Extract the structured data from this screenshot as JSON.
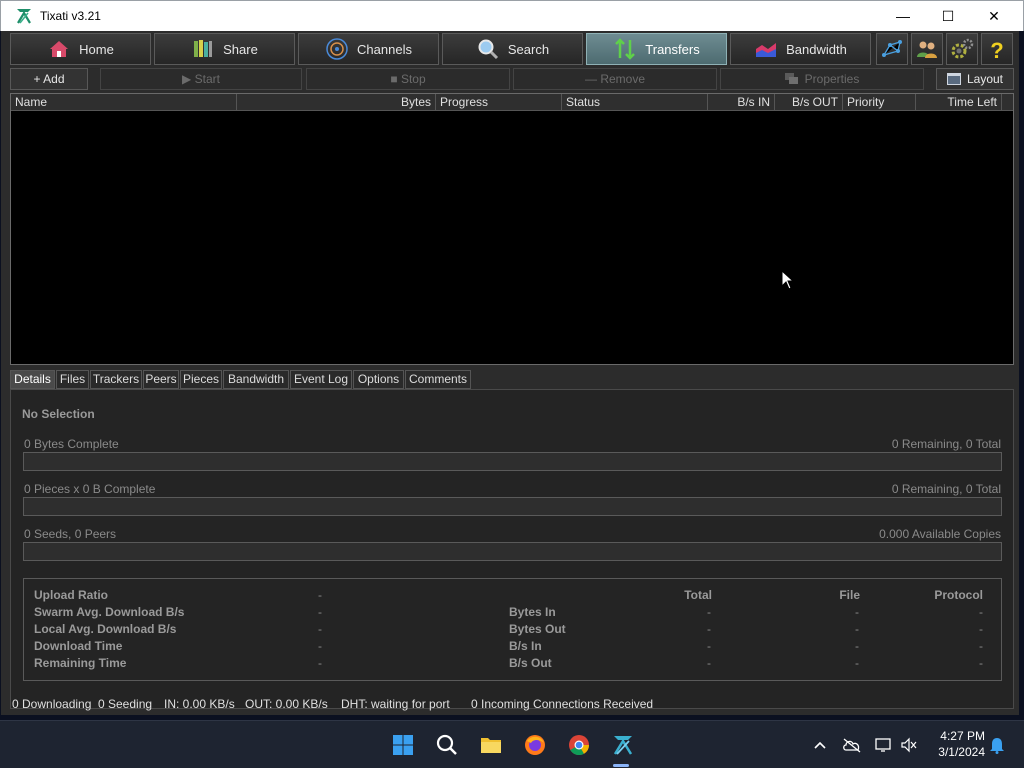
{
  "window": {
    "title": "Tixati v3.21",
    "minimize": "—",
    "maximize": "☐",
    "close": "✕"
  },
  "nav": {
    "home": "Home",
    "share": "Share",
    "channels": "Channels",
    "search": "Search",
    "transfers": "Transfers",
    "bandwidth": "Bandwidth",
    "active": "Transfers"
  },
  "toolbar": {
    "add": "+ Add",
    "start": "▶ Start",
    "stop": "■ Stop",
    "remove": "— Remove",
    "properties": "Properties",
    "layout": "Layout"
  },
  "table": {
    "columns": [
      "Name",
      "Bytes",
      "Progress",
      "Status",
      "B/s IN",
      "B/s OUT",
      "Priority",
      "Time Left"
    ],
    "rows": []
  },
  "tabs": [
    "Details",
    "Files",
    "Trackers",
    "Peers",
    "Pieces",
    "Bandwidth",
    "Event Log",
    "Options",
    "Comments"
  ],
  "active_tab": "Details",
  "details": {
    "selection": "No Selection",
    "bytes_complete": "0 Bytes Complete",
    "bytes_remaining": "0 Remaining,  0 Total",
    "pieces_complete": "0 Pieces  x  0 B Complete",
    "pieces_remaining": "0 Remaining,  0 Total",
    "seeds_peers": "0 Seeds, 0 Peers",
    "available_copies": "0.000 Available Copies",
    "stats_left": [
      {
        "label": "Upload Ratio",
        "value": "-"
      },
      {
        "label": "Swarm Avg. Download B/s",
        "value": "-"
      },
      {
        "label": "Local Avg. Download B/s",
        "value": "-"
      },
      {
        "label": "Download Time",
        "value": "-"
      },
      {
        "label": "Remaining Time",
        "value": "-"
      }
    ],
    "stats_headers": [
      "Total",
      "File",
      "Protocol"
    ],
    "stats_right": [
      {
        "label": "Bytes In",
        "total": "-",
        "file": "-",
        "protocol": "-"
      },
      {
        "label": "Bytes Out",
        "total": "-",
        "file": "-",
        "protocol": "-"
      },
      {
        "label": "B/s In",
        "total": "-",
        "file": "-",
        "protocol": "-"
      },
      {
        "label": "B/s Out",
        "total": "-",
        "file": "-",
        "protocol": "-"
      }
    ]
  },
  "status": {
    "downloading": "0 Downloading",
    "seeding": "0 Seeding",
    "in": "IN: 0.00 KB/s",
    "out": "OUT: 0.00 KB/s",
    "dht": "DHT: waiting for port",
    "incoming": "0 Incoming Connections Received"
  },
  "taskbar": {
    "time": "4:27 PM",
    "date": "3/1/2024",
    "apps": [
      "start-icon",
      "search-icon",
      "file-explorer-icon",
      "firefox-icon",
      "chrome-icon",
      "tixati-icon"
    ]
  },
  "colors": {
    "accent_active": "#5e7e83",
    "background": "#2c2c2c",
    "table_bg": "#000000"
  }
}
